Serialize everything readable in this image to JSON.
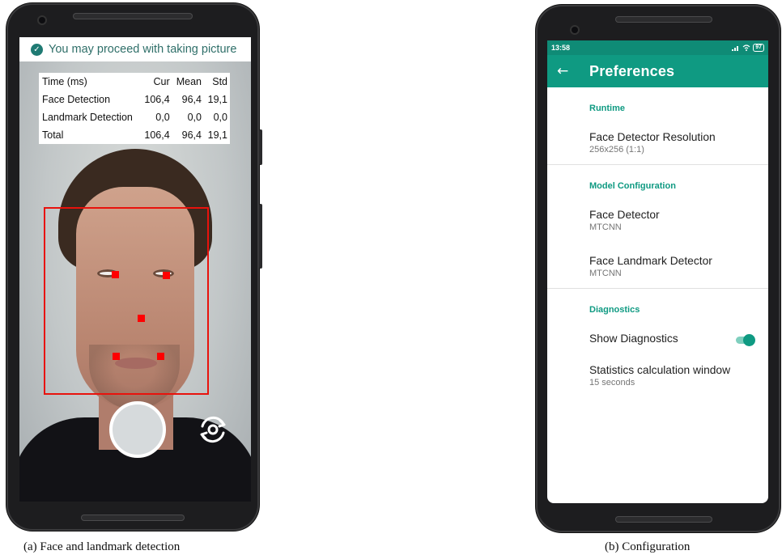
{
  "left_phone": {
    "banner": {
      "icon": "check-circle-icon",
      "text": "You may proceed with taking picture"
    },
    "stats_table": {
      "headers": [
        "Time (ms)",
        "Cur",
        "Mean",
        "Std"
      ],
      "rows": [
        [
          "Face Detection",
          "106,4",
          "96,4",
          "19,1"
        ],
        [
          "Landmark Detection",
          "0,0",
          "0,0",
          "0,0"
        ],
        [
          "Total",
          "106,4",
          "96,4",
          "19,1"
        ]
      ]
    },
    "controls": {
      "shutter_icon": "shutter-button",
      "switch_icon": "switch-camera-icon"
    },
    "colors": {
      "banner_text": "#2f6f69",
      "face_box": "#e8120c",
      "landmark": "#ff0000"
    }
  },
  "right_phone": {
    "status_bar": {
      "time": "13:58",
      "battery": "97"
    },
    "app_bar": {
      "title": "Preferences",
      "back_icon": "arrow-back-icon"
    },
    "sections": [
      {
        "header": "Runtime",
        "items": [
          {
            "title": "Face Detector Resolution",
            "summary": "256x256 (1:1)"
          }
        ]
      },
      {
        "header": "Model Configuration",
        "items": [
          {
            "title": "Face Detector",
            "summary": "MTCNN"
          },
          {
            "title": "Face Landmark Detector",
            "summary": "MTCNN"
          }
        ]
      },
      {
        "header": "Diagnostics",
        "items": [
          {
            "title": "Show Diagnostics",
            "toggle_on": true
          },
          {
            "title": "Statistics calculation window",
            "summary": "15 seconds"
          }
        ]
      }
    ],
    "colors": {
      "primary": "#0f9a82",
      "status_bar": "#0f8b76"
    }
  },
  "captions": {
    "left": "(a) Face and landmark detection",
    "right": "(b) Configuration"
  }
}
